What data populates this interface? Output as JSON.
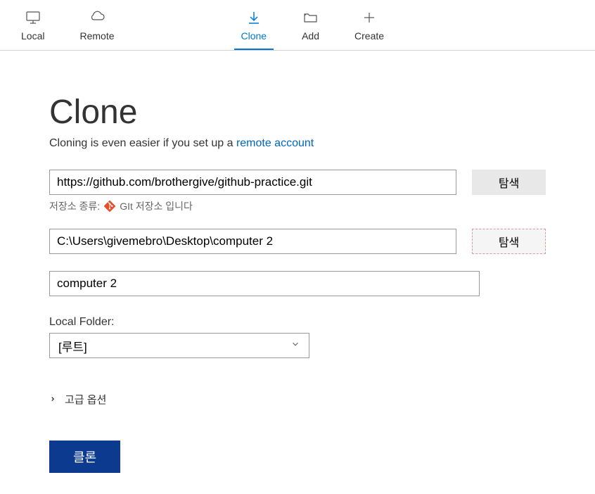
{
  "toolbar": {
    "local": "Local",
    "remote": "Remote",
    "clone": "Clone",
    "add": "Add",
    "create": "Create"
  },
  "page": {
    "title": "Clone",
    "subtitle_prefix": "Cloning is even easier if you set up a ",
    "subtitle_link": "remote account"
  },
  "form": {
    "source_url": "https://github.com/brothergive/github-practice.git",
    "browse1": "탐색",
    "repo_type_label": "저장소 종류:",
    "repo_type_text": "GIt 저장소 입니다",
    "dest_path": "C:\\Users\\givemebro\\Desktop\\computer 2",
    "browse2": "탐색",
    "name": "computer 2",
    "local_folder_label": "Local Folder:",
    "local_folder_value": "[루트]",
    "advanced": "고급 옵션",
    "submit": "클론"
  }
}
